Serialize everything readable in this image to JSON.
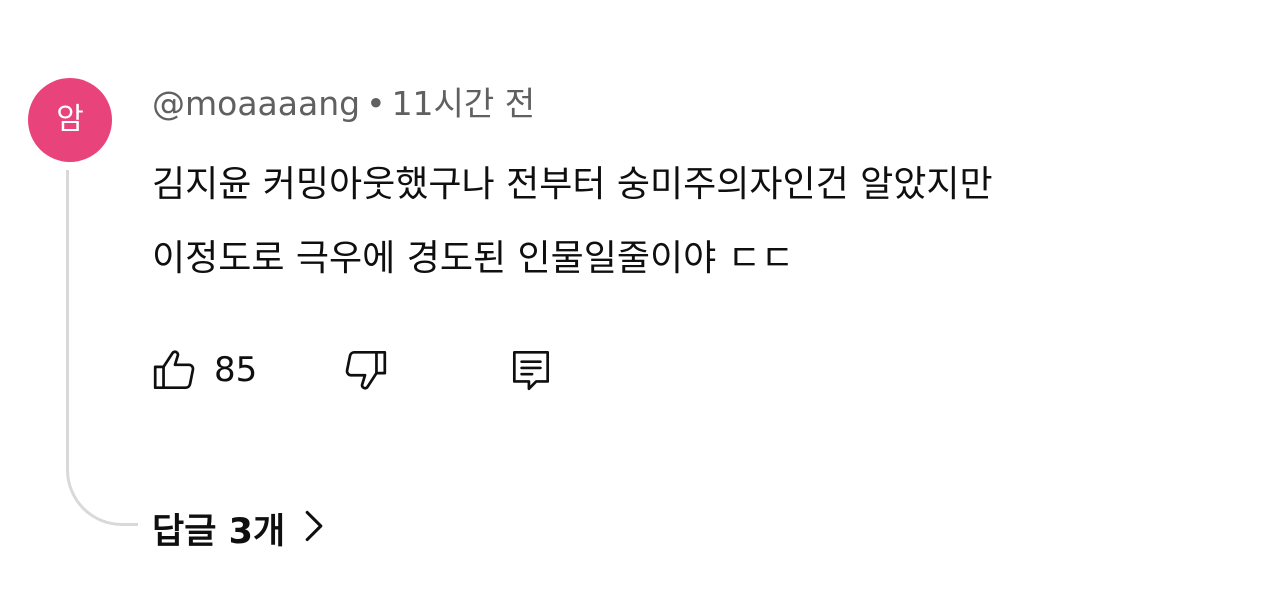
{
  "comment": {
    "avatar": {
      "letter": "암",
      "color": "#e8437a"
    },
    "author": "@moaaaang",
    "separator": "•",
    "time": "11시간 전",
    "lines": [
      "김지윤 커밍아웃했구나 전부터 숭미주의자인건 알았지만",
      "이정도로 극우에 경도된 인물일줄이야 ㄷㄷ"
    ],
    "actions": {
      "like_icon": "thumbs-up-icon",
      "like_count": "85",
      "dislike_icon": "thumbs-down-icon",
      "reply_icon": "comment-icon"
    },
    "replies": {
      "label": "답글 3개",
      "icon": "chevron-right-icon"
    }
  },
  "colors": {
    "text_primary": "#0f0f0f",
    "text_secondary": "#606060",
    "thread_line": "#d9d9d9",
    "avatar_bg": "#e8437a"
  }
}
